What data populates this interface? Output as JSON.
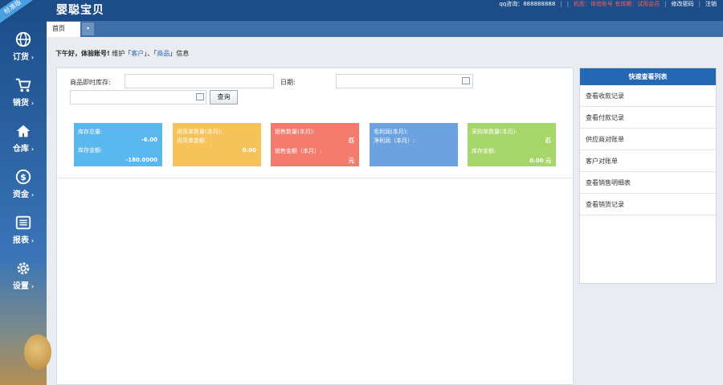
{
  "app": {
    "ribbon": "标准版",
    "title": "婴聪宝贝"
  },
  "header": {
    "qq": "qq咨询：888888888",
    "red_text": "机型：体验账号  有效期：试用会员",
    "change_password": "修改密码",
    "logout": "注销"
  },
  "tabs": {
    "home": "首页",
    "dropdown": "▾"
  },
  "sidebar": {
    "items": [
      {
        "label": "订货",
        "icon": "globe-icon"
      },
      {
        "label": "销货",
        "icon": "cart-icon"
      },
      {
        "label": "仓库",
        "icon": "home-icon"
      },
      {
        "label": "资金",
        "icon": "dollar-icon"
      },
      {
        "label": "报表",
        "icon": "report-icon"
      },
      {
        "label": "设置",
        "icon": "gear-icon"
      }
    ],
    "arrow": "›"
  },
  "greeting": {
    "prefix": "下午好，体验账号!",
    "mid": " 维护「",
    "link1": "客户",
    "sep": "」、「",
    "link2": "商品",
    "suffix": "」信息"
  },
  "query": {
    "product_label": "商品即时库存:",
    "product_value": "",
    "date_label": "日期:",
    "date_value": "",
    "date2_value": "",
    "button": "查询"
  },
  "cards": [
    {
      "color": "#5bb8ef",
      "rows": [
        {
          "label": "库存总量:",
          "value": "-6.00"
        },
        {
          "label": "库存金额:",
          "value": "-180.0000"
        }
      ]
    },
    {
      "color": "#f6c25a",
      "rows": [
        {
          "label": "进货单数量(本月):",
          "value": ""
        },
        {
          "label": "进货单金额:",
          "value": "0.00"
        }
      ]
    },
    {
      "color": "#f47c6f",
      "rows": [
        {
          "label": "销售数量(本月):",
          "value": "匹"
        },
        {
          "label": "销售金额（本月）:",
          "value": "元"
        }
      ]
    },
    {
      "color": "#6ca2e0",
      "rows": [
        {
          "label": "毛利润(本月):",
          "value": ""
        },
        {
          "label": "净利润（本月）:",
          "value": ""
        }
      ]
    },
    {
      "color": "#a7d66a",
      "rows": [
        {
          "label": "采购单数量(本月):",
          "value": "匹"
        },
        {
          "label": "库存金额:",
          "value": "0.00 元"
        }
      ]
    }
  ],
  "quick_panel": {
    "title": "快速查看列表",
    "items": [
      "查看收款记录",
      "查看付款记录",
      "供应商对账单",
      "客户对账单",
      "查看销售明细表",
      "查看销货记录"
    ]
  }
}
